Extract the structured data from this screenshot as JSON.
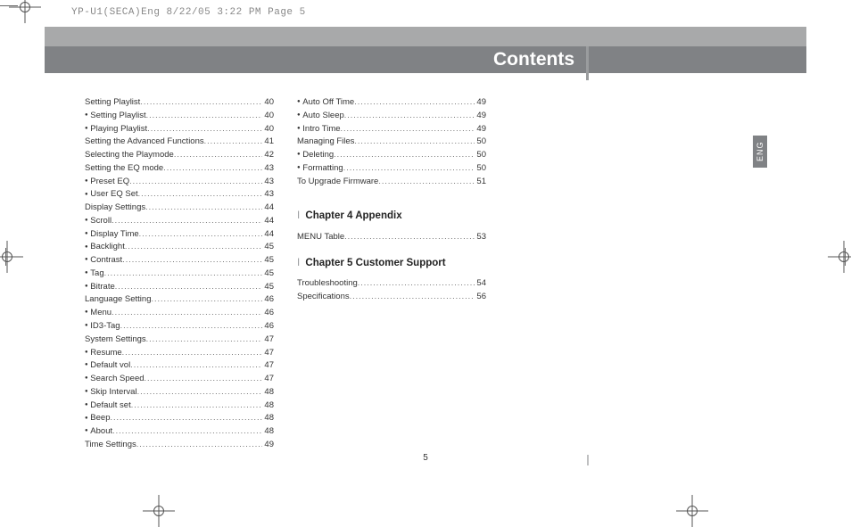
{
  "print_header": "YP-U1(SECA)Eng  8/22/05 3:22 PM  Page 5",
  "title": "Contents",
  "eng_tab": "ENG",
  "page_number": "5",
  "col1": [
    {
      "label": "Setting Playlist",
      "pg": "40",
      "sub": false
    },
    {
      "label": "Setting Playlist",
      "pg": "40",
      "sub": true
    },
    {
      "label": "Playing Playlist",
      "pg": "40",
      "sub": true
    },
    {
      "label": "Setting the Advanced Functions",
      "pg": "41",
      "sub": false
    },
    {
      "label": "Selecting the Playmode",
      "pg": "42",
      "sub": false
    },
    {
      "label": "Setting the EQ mode",
      "pg": "43",
      "sub": false
    },
    {
      "label": "Preset EQ",
      "pg": "43",
      "sub": true
    },
    {
      "label": "User EQ Set",
      "pg": "43",
      "sub": true
    },
    {
      "label": "Display Settings",
      "pg": "44",
      "sub": false
    },
    {
      "label": "Scroll",
      "pg": "44",
      "sub": true
    },
    {
      "label": "Display Time",
      "pg": "44",
      "sub": true
    },
    {
      "label": "Backlight",
      "pg": "45",
      "sub": true
    },
    {
      "label": "Contrast",
      "pg": "45",
      "sub": true
    },
    {
      "label": "Tag",
      "pg": "45",
      "sub": true
    },
    {
      "label": "Bitrate",
      "pg": "45",
      "sub": true
    },
    {
      "label": "Language Setting",
      "pg": "46",
      "sub": false
    },
    {
      "label": "Menu",
      "pg": "46",
      "sub": true
    },
    {
      "label": "ID3-Tag",
      "pg": "46",
      "sub": true
    },
    {
      "label": "System Settings",
      "pg": "47",
      "sub": false
    },
    {
      "label": "Resume",
      "pg": "47",
      "sub": true
    },
    {
      "label": "Default vol",
      "pg": "47",
      "sub": true
    },
    {
      "label": "Search Speed",
      "pg": "47",
      "sub": true
    },
    {
      "label": "Skip Interval",
      "pg": "48",
      "sub": true
    },
    {
      "label": "Default set",
      "pg": "48",
      "sub": true
    },
    {
      "label": "Beep",
      "pg": "48",
      "sub": true
    },
    {
      "label": "About",
      "pg": "48",
      "sub": true
    },
    {
      "label": "Time Settings",
      "pg": "49",
      "sub": false
    }
  ],
  "col2_top": [
    {
      "label": "Auto Off Time",
      "pg": "49",
      "sub": true
    },
    {
      "label": "Auto Sleep",
      "pg": "49",
      "sub": true
    },
    {
      "label": "Intro Time",
      "pg": "49",
      "sub": true
    },
    {
      "label": "Managing Files",
      "pg": "50",
      "sub": false
    },
    {
      "label": "Deleting",
      "pg": "50",
      "sub": true
    },
    {
      "label": "Formatting",
      "pg": "50",
      "sub": true
    },
    {
      "label": "To Upgrade Firmware",
      "pg": "51",
      "sub": false
    }
  ],
  "chapter4_title": "Chapter 4  Appendix",
  "chapter4_items": [
    {
      "label": "MENU Table",
      "pg": "53",
      "sub": false
    }
  ],
  "chapter5_title": "Chapter 5  Customer Support",
  "chapter5_items": [
    {
      "label": "Troubleshooting",
      "pg": "54",
      "sub": false
    },
    {
      "label": "Specifications",
      "pg": "56",
      "sub": false
    }
  ]
}
